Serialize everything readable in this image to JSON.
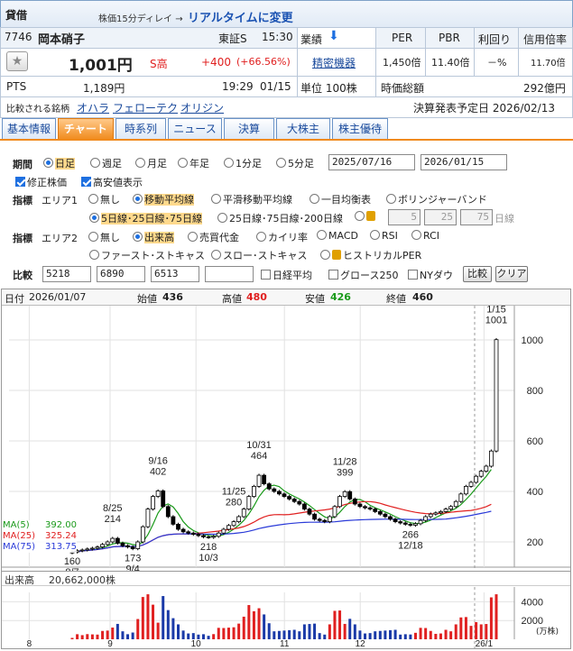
{
  "header": {
    "label": "貸借",
    "delay": "株価15分ディレイ →",
    "realtime": "リアルタイムに変更"
  },
  "stock": {
    "code": "7746",
    "name": "岡本硝子",
    "market": "東証S",
    "time": "15:30",
    "price": "1,001円",
    "s_high": "S高",
    "change": "+400",
    "change_pct": "(+66.56%)",
    "pts_label": "PTS",
    "pts_price": "1,189円",
    "pts_time": "19:29",
    "pts_date": "01/15",
    "gyoseki_label": "業績",
    "seimitsu": "精密機器",
    "unit": "単位 100株",
    "per_label": "PER",
    "per": "1,450倍",
    "pbr_label": "PBR",
    "pbr": "11.40倍",
    "yield_label": "利回り",
    "yield": "－%",
    "margin_label": "信用倍率",
    "margin": "11.70倍",
    "mcap_label": "時価総額",
    "mcap": "292億円",
    "compare_label": "比較される銘柄",
    "compare": [
      "オハラ",
      "フェローテク",
      "オリジン"
    ],
    "earnings": "決算発表予定日 2026/02/13"
  },
  "tabs": [
    "基本情報",
    "チャート",
    "時系列",
    "ニュース",
    "決算",
    "大株主",
    "株主優待"
  ],
  "controls": {
    "period_label": "期間",
    "periods": [
      "日足",
      "週足",
      "月足",
      "年足",
      "1分足",
      "5分足"
    ],
    "date_from": "2025/07/16",
    "date_to": "2026/01/15",
    "adj": "修正株価",
    "hilo": "高安値表示",
    "ind_label": "指標",
    "area1": "エリア1",
    "area1_opts": [
      "無し",
      "移動平均線",
      "平滑移動平均線",
      "一目均衡表",
      "ボリンジャーバンド"
    ],
    "ma_opts": [
      "5日線･25日線･75日線",
      "25日線･75日線･200日線"
    ],
    "ma_custom": [
      "5",
      "25",
      "75"
    ],
    "ma_custom_unit": "日線",
    "area2": "エリア2",
    "area2_opts": [
      "無し",
      "出来高",
      "売買代金",
      "カイリ率",
      "MACD",
      "RSI",
      "RCI"
    ],
    "area2_opts2": [
      "ファースト･ストキャス",
      "スロー･ストキャス",
      "ヒストリカルPER"
    ],
    "cmp_label": "比較",
    "cmp_codes": [
      "5218",
      "6890",
      "6513",
      ""
    ],
    "cmp_checks": [
      "日経平均",
      "グロース250",
      "NYダウ"
    ],
    "cmp_btn": "比較",
    "clear_btn": "クリア"
  },
  "chart_data": {
    "type": "candlestick",
    "ohlc_header": {
      "date_label": "日付",
      "date": "2026/01/07",
      "open_label": "始値",
      "open": "436",
      "high_label": "高値",
      "high": "480",
      "low_label": "安値",
      "low": "426",
      "close_label": "終値",
      "close": "460"
    },
    "y_ticks": [
      "1000",
      "800",
      "600",
      "400",
      "200"
    ],
    "ylim": [
      100,
      1100
    ],
    "x_ticks": [
      "8",
      "9",
      "10",
      "11",
      "12",
      "26/1"
    ],
    "annotations": [
      {
        "date": "8/7",
        "value": "160"
      },
      {
        "date": "8/25",
        "value": "214"
      },
      {
        "date": "9/4",
        "value": "173"
      },
      {
        "date": "9/16",
        "value": "402"
      },
      {
        "date": "10/3",
        "value": "218"
      },
      {
        "date": "10/31",
        "value": "464"
      },
      {
        "date": "11/25",
        "value": "280"
      },
      {
        "date": "11/28",
        "value": "399"
      },
      {
        "date": "12/18",
        "value": "266"
      },
      {
        "date": "1/15",
        "value": "1001"
      }
    ],
    "ma": [
      {
        "name": "MA(5)",
        "value": "392.00",
        "color": "#1a9a1a"
      },
      {
        "name": "MA(25)",
        "value": "325.24",
        "color": "#e02020"
      },
      {
        "name": "MA(75)",
        "value": "313.75",
        "color": "#2a3ad8"
      }
    ],
    "volume_label": "出来高",
    "volume_value": "20,662,000株",
    "volume_ticks": [
      "4000",
      "2000"
    ],
    "volume_unit": "(万株)",
    "series": [
      {
        "name": "close",
        "values": [
          160,
          165,
          168,
          172,
          175,
          180,
          190,
          200,
          214,
          195,
          185,
          180,
          173,
          200,
          260,
          330,
          380,
          402,
          340,
          300,
          270,
          250,
          240,
          235,
          230,
          225,
          220,
          218,
          222,
          235,
          250,
          265,
          280,
          300,
          330,
          380,
          420,
          464,
          430,
          410,
          400,
          390,
          380,
          370,
          360,
          350,
          330,
          310,
          290,
          285,
          280,
          300,
          340,
          380,
          399,
          370,
          350,
          340,
          335,
          330,
          320,
          310,
          300,
          290,
          280,
          275,
          270,
          266,
          272,
          285,
          300,
          310,
          315,
          320,
          330,
          340,
          360,
          390,
          420,
          436,
          460,
          480,
          500,
          560,
          1001
        ]
      }
    ]
  }
}
